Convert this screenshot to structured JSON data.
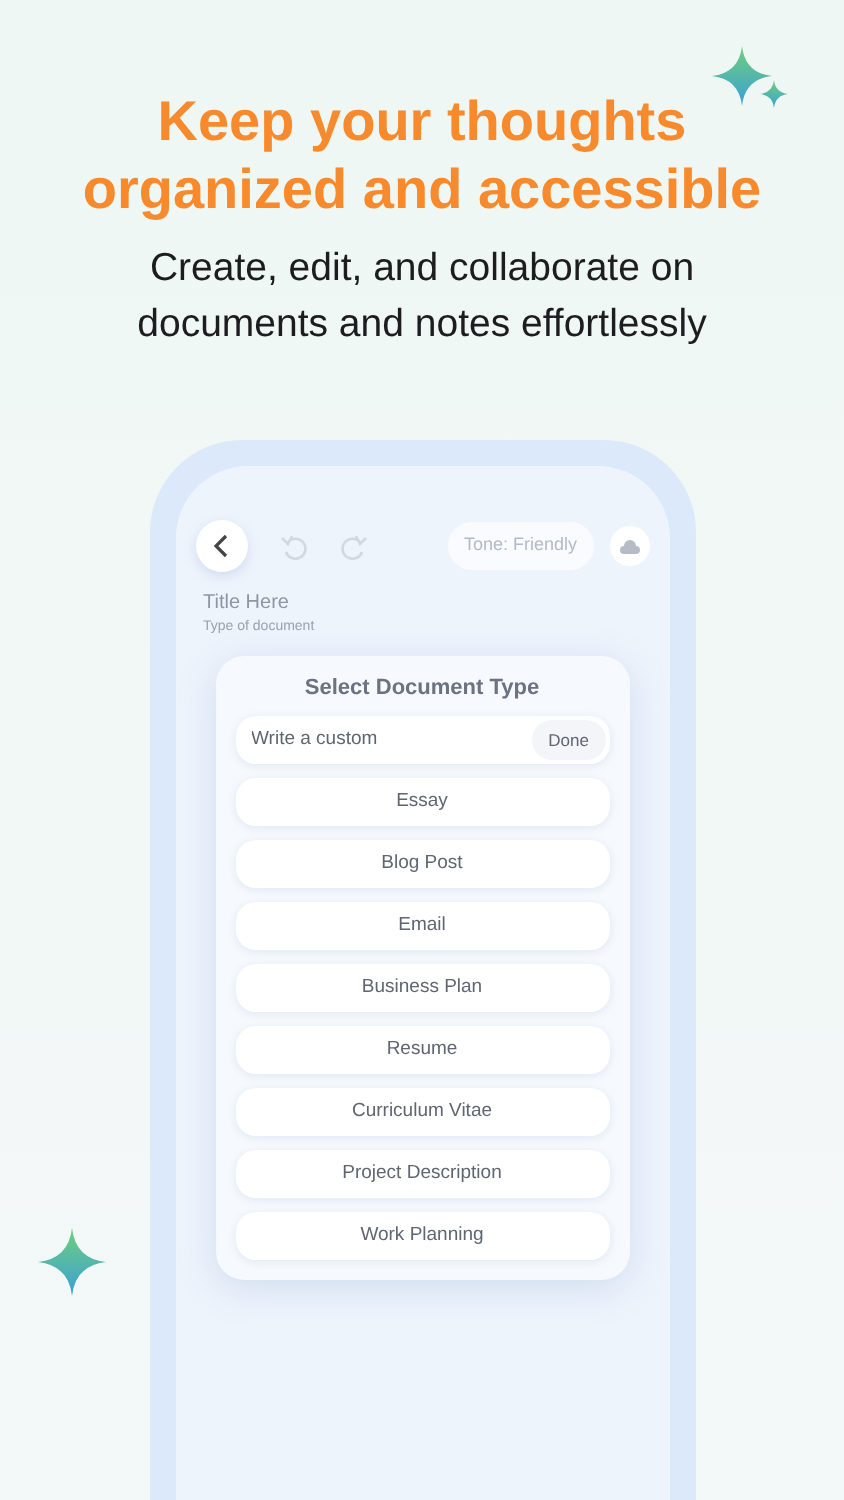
{
  "headline": "Keep your thoughts organized and accessible",
  "subtitle": "Create, edit, and collaborate on documents and notes effortlessly",
  "toolbar": {
    "tone": "Tone: Friendly"
  },
  "document": {
    "title": "Title Here",
    "subtitle": "Type of document"
  },
  "sheet": {
    "title": "Select Document Type",
    "custom": {
      "placeholder": "Write a custom",
      "button": "Done"
    },
    "options": [
      "Essay",
      "Blog Post",
      "Email",
      "Business Plan",
      "Resume",
      "Curriculum Vitae",
      "Project Description",
      "Work Planning"
    ]
  }
}
